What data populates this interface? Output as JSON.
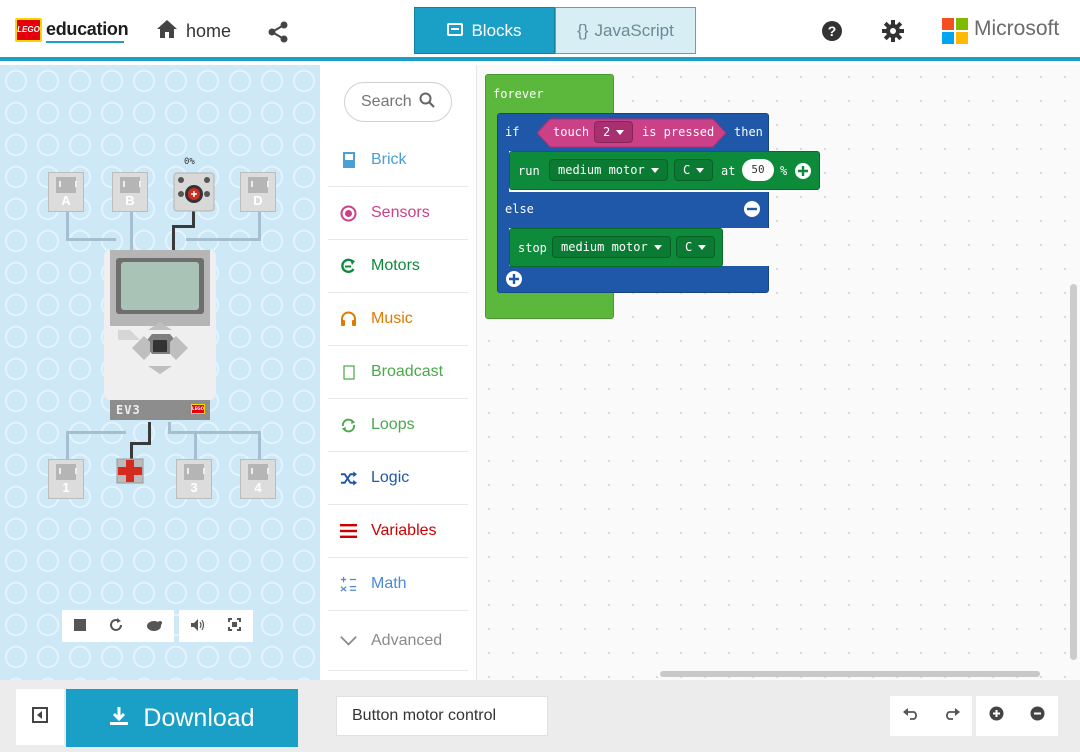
{
  "header": {
    "brand_logo_text": "LEGO",
    "brand_name": "education",
    "home_label": "home",
    "tabs": [
      {
        "label": "Blocks",
        "icon": "blocks-icon",
        "active": true
      },
      {
        "label": "JavaScript",
        "prefix": "{}",
        "active": false
      }
    ],
    "vendor_name": "Microsoft",
    "colors": {
      "accent": "#1a9fc6",
      "ms_red": "#f25022",
      "ms_green": "#7fba00",
      "ms_blue": "#00a4ef",
      "ms_yellow": "#ffb900"
    }
  },
  "simulator": {
    "input_ports": [
      "A",
      "B",
      "D"
    ],
    "sensor_ports": [
      "1",
      "3",
      "4"
    ],
    "motor_reading": "0%",
    "brick_label": "EV3",
    "brick_logo_text": "LEGO",
    "toolbar_icons": [
      "stop-icon",
      "restart-icon",
      "slow-motion-icon",
      "sound-icon",
      "fullscreen-icon"
    ]
  },
  "toolbox": {
    "search_placeholder": "Search",
    "categories": [
      {
        "label": "Brick",
        "color": "#4a9fd4",
        "icon": "brick-icon"
      },
      {
        "label": "Sensors",
        "color": "#cc4088",
        "icon": "sensors-icon"
      },
      {
        "label": "Motors",
        "color": "#0d8a3a",
        "icon": "motors-icon"
      },
      {
        "label": "Music",
        "color": "#e07a00",
        "icon": "music-icon"
      },
      {
        "label": "Broadcast",
        "color": "#4aa84a",
        "icon": "broadcast-icon"
      },
      {
        "label": "Loops",
        "color": "#4aa84a",
        "icon": "loops-icon"
      },
      {
        "label": "Logic",
        "color": "#1f58a8",
        "icon": "logic-icon"
      },
      {
        "label": "Variables",
        "color": "#cc0000",
        "icon": "variables-icon"
      },
      {
        "label": "Math",
        "color": "#4f8ad0",
        "icon": "math-icon"
      },
      {
        "label": "Advanced",
        "color": "#8a8a8a",
        "icon": "advanced-icon"
      }
    ]
  },
  "workspace": {
    "forever_label": "forever",
    "if_label": "if",
    "touch_label": "touch",
    "touch_port": "2",
    "pressed_label": "is pressed",
    "then_label": "then",
    "run_label": "run",
    "motor_type": "medium motor",
    "motor_port": "C",
    "at_label": "at",
    "speed_value": "50",
    "percent_label": "%",
    "else_label": "else",
    "stop_label": "stop",
    "stop_motor_type": "medium motor",
    "stop_motor_port": "C",
    "colors": {
      "loops": "#5cb83c",
      "logic": "#1f58a8",
      "motors": "#0d8a3a",
      "sensors": "#cc4088"
    }
  },
  "footer": {
    "download_label": "Download",
    "project_name": "Button motor control"
  }
}
